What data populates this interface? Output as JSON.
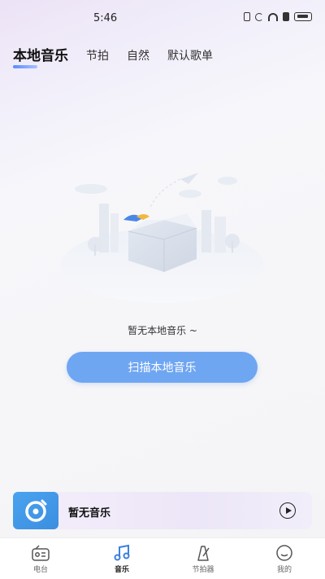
{
  "status": {
    "time": "5:46"
  },
  "tabs": [
    {
      "label": "本地音乐",
      "active": true
    },
    {
      "label": "节拍",
      "active": false
    },
    {
      "label": "自然",
      "active": false
    },
    {
      "label": "默认歌单",
      "active": false
    }
  ],
  "empty_state": {
    "message": "暂无本地音乐 ~",
    "scan_button": "扫描本地音乐"
  },
  "player": {
    "title": "暂无音乐",
    "cover_icon": "music-disc-icon",
    "play_icon": "play-circle-icon"
  },
  "bottom_nav": [
    {
      "label": "电台",
      "icon": "radio-icon",
      "active": false
    },
    {
      "label": "音乐",
      "icon": "music-note-icon",
      "active": true
    },
    {
      "label": "节拍器",
      "icon": "metronome-icon",
      "active": false
    },
    {
      "label": "我的",
      "icon": "smile-face-icon",
      "active": false
    }
  ],
  "colors": {
    "accent": "#6fa6f2",
    "active_nav": "#3d7fe0",
    "cover": "#3b8ee0"
  }
}
